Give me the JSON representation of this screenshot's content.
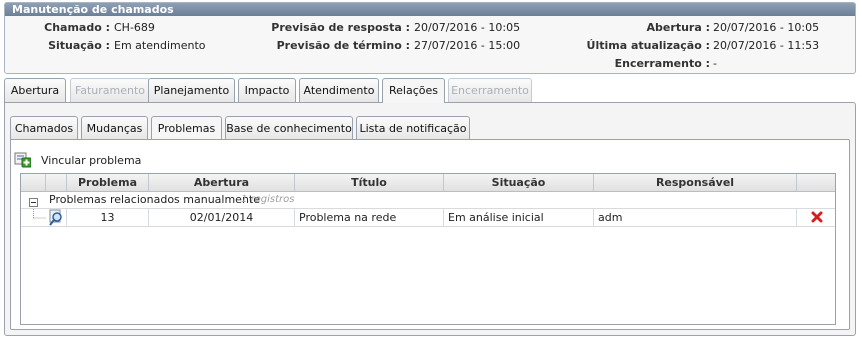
{
  "panel": {
    "title": "Manutenção de chamados",
    "chamado_label": "Chamado :",
    "chamado_value": "CH-689",
    "situacao_label": "Situação :",
    "situacao_value": "Em atendimento",
    "prev_resposta_label": "Previsão de resposta :",
    "prev_resposta_value": "20/07/2016 - 10:05",
    "prev_termino_label": "Previsão de término :",
    "prev_termino_value": "27/07/2016 - 15:00",
    "abertura_label": "Abertura :",
    "abertura_value": "20/07/2016 - 10:05",
    "ultima_label": "Última atualização :",
    "ultima_value": "20/07/2016 - 11:53",
    "encerramento_label": "Encerramento :",
    "encerramento_value": "-"
  },
  "main_tabs": [
    {
      "label": "Abertura",
      "state": "normal"
    },
    {
      "label": "Faturamento",
      "state": "disabled"
    },
    {
      "label": "Planejamento",
      "state": "normal"
    },
    {
      "label": "Impacto",
      "state": "normal"
    },
    {
      "label": "Atendimento",
      "state": "normal"
    },
    {
      "label": "Relações",
      "state": "active"
    },
    {
      "label": "Encerramento",
      "state": "disabled"
    }
  ],
  "sub_tabs": [
    {
      "label": "Chamados",
      "state": "normal"
    },
    {
      "label": "Mudanças",
      "state": "normal"
    },
    {
      "label": "Problemas",
      "state": "active"
    },
    {
      "label": "Base de conhecimento",
      "state": "normal"
    },
    {
      "label": "Lista de notificação",
      "state": "normal"
    }
  ],
  "toolbar": {
    "vincular_label": "Vincular problema",
    "vincular_icon": "add-link-icon"
  },
  "grid": {
    "columns": [
      "Problema",
      "Abertura",
      "Título",
      "Situação",
      "Responsável"
    ],
    "group_label": "Problemas relacionados manualmente",
    "group_count": "1 registros",
    "rows": [
      {
        "problema": "13",
        "abertura": "02/01/2014",
        "titulo": "Problema na rede",
        "situacao": "Em análise inicial",
        "responsavel": "adm"
      }
    ]
  },
  "colors": {
    "panel_header": "#7a8ca3",
    "delete": "#d21f1f",
    "add": "#3a9a2a"
  }
}
